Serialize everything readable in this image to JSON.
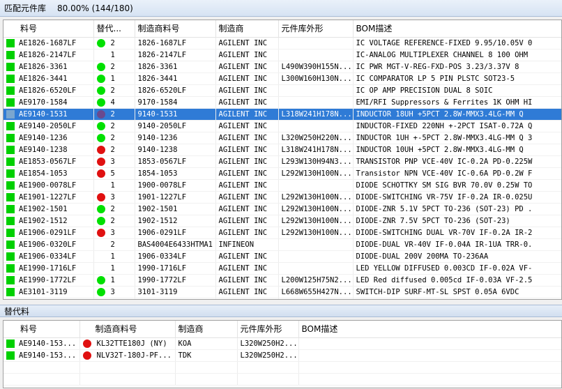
{
  "title": {
    "label": "匹配元件库",
    "progress": "80.00% (144/180)"
  },
  "main_table": {
    "headers": [
      "料号",
      "替代...",
      "制造商料号",
      "制造商",
      "元件库外形",
      "BOM描述"
    ],
    "rows": [
      {
        "part": "AE1826-1687LF",
        "dot": "green",
        "alt": "2",
        "mfr_part": "1826-1687LF",
        "mfr": "AGILENT INC",
        "footprint": "",
        "desc": "IC VOLTAGE REFERENCE-FIXED 9.95/10.05V 0"
      },
      {
        "part": "AE1826-2147LF",
        "dot": "none",
        "alt": "1",
        "mfr_part": "1826-2147LF",
        "mfr": "AGILENT INC",
        "footprint": "",
        "desc": "IC-ANALOG MULTIPLEXER CHANNEL 8 100 OHM"
      },
      {
        "part": "AE1826-3361",
        "dot": "green",
        "alt": "2",
        "mfr_part": "1826-3361",
        "mfr": "AGILENT INC",
        "footprint": "L490W390H155N...",
        "desc": "IC PWR MGT-V-REG-FXD-POS 3.23/3.37V 8"
      },
      {
        "part": "AE1826-3441",
        "dot": "green",
        "alt": "1",
        "mfr_part": "1826-3441",
        "mfr": "AGILENT INC",
        "footprint": "L300W160H130N...",
        "desc": "IC COMPARATOR LP 5 PIN PLSTC SOT23-5"
      },
      {
        "part": "AE1826-6520LF",
        "dot": "green",
        "alt": "2",
        "mfr_part": "1826-6520LF",
        "mfr": "AGILENT INC",
        "footprint": "",
        "desc": "IC OP AMP PRECISION DUAL 8 SOIC"
      },
      {
        "part": "AE9170-1584",
        "dot": "green",
        "alt": "4",
        "mfr_part": "9170-1584",
        "mfr": "AGILENT INC",
        "footprint": "",
        "desc": "EMI/RFI Suppressors & Ferrites 1K OHM HI"
      },
      {
        "part": "AE9140-1531",
        "dot": "purple",
        "alt": "2",
        "mfr_part": "9140-1531",
        "mfr": "AGILENT INC",
        "footprint": "L318W241H178N...",
        "desc": "INDUCTOR 18UH +5PCT 2.8W-MMX3.4LG-MM Q",
        "selected": true
      },
      {
        "part": "AE9140-2050LF",
        "dot": "green",
        "alt": "2",
        "mfr_part": "9140-2050LF",
        "mfr": "AGILENT INC",
        "footprint": "",
        "desc": "INDUCTOR-FIXED 220NH +-2PCT ISAT-0.72A Q"
      },
      {
        "part": "AE9140-1236",
        "dot": "green",
        "alt": "2",
        "mfr_part": "9140-1236",
        "mfr": "AGILENT INC",
        "footprint": "L320W250H220N...",
        "desc": "INDUCTOR 1UH +-5PCT 2.8W-MMX3.4LG-MM Q 3"
      },
      {
        "part": "AE9140-1238",
        "dot": "red",
        "alt": "2",
        "mfr_part": "9140-1238",
        "mfr": "AGILENT INC",
        "footprint": "L318W241H178N...",
        "desc": "INDUCTOR 10UH +5PCT 2.8W-MMX3.4LG-MM Q"
      },
      {
        "part": "AE1853-0567LF",
        "dot": "red",
        "alt": "3",
        "mfr_part": "1853-0567LF",
        "mfr": "AGILENT INC",
        "footprint": "L293W130H94N3...",
        "desc": "TRANSISTOR PNP VCE-40V IC-0.2A PD-0.225W"
      },
      {
        "part": "AE1854-1053",
        "dot": "red",
        "alt": "5",
        "mfr_part": "1854-1053",
        "mfr": "AGILENT INC",
        "footprint": "L292W130H100N...",
        "desc": "Transistor NPN VCE-40V IC-0.6A PD-0.2W F"
      },
      {
        "part": "AE1900-0078LF",
        "dot": "none",
        "alt": "1",
        "mfr_part": "1900-0078LF",
        "mfr": "AGILENT INC",
        "footprint": "",
        "desc": "DIODE SCHOTTKY SM SIG BVR 70.0V 0.25W TO"
      },
      {
        "part": "AE1901-1227LF",
        "dot": "red",
        "alt": "3",
        "mfr_part": "1901-1227LF",
        "mfr": "AGILENT INC",
        "footprint": "L292W130H100N...",
        "desc": "DIODE-SWITCHING VR-75V IF-0.2A IR-0.025U"
      },
      {
        "part": "AE1902-1501",
        "dot": "green",
        "alt": "2",
        "mfr_part": "1902-1501",
        "mfr": "AGILENT INC",
        "footprint": "L292W130H100N...",
        "desc": "DIODE-ZNR 5.1V 5PCT TO-236 (SOT-23) PD ."
      },
      {
        "part": "AE1902-1512",
        "dot": "green",
        "alt": "2",
        "mfr_part": "1902-1512",
        "mfr": "AGILENT INC",
        "footprint": "L292W130H100N...",
        "desc": "DIODE-ZNR 7.5V 5PCT TO-236 (SOT-23)"
      },
      {
        "part": "AE1906-0291LF",
        "dot": "red",
        "alt": "3",
        "mfr_part": "1906-0291LF",
        "mfr": "AGILENT INC",
        "footprint": "L292W130H100N...",
        "desc": "DIODE-SWITCHING DUAL VR-70V IF-0.2A IR-2"
      },
      {
        "part": "AE1906-0320LF",
        "dot": "none",
        "alt": "2",
        "mfr_part": "BAS4004E6433HTMA1",
        "mfr": "INFINEON",
        "footprint": "",
        "desc": "DIODE-DUAL VR-40V IF-0.04A IR-1UA TRR-0."
      },
      {
        "part": "AE1906-0334LF",
        "dot": "none",
        "alt": "1",
        "mfr_part": "1906-0334LF",
        "mfr": "AGILENT INC",
        "footprint": "",
        "desc": "DIODE-DUAL 200V 200MA TO-236AA"
      },
      {
        "part": "AE1990-1716LF",
        "dot": "none",
        "alt": "1",
        "mfr_part": "1990-1716LF",
        "mfr": "AGILENT INC",
        "footprint": "",
        "desc": "LED YELLOW DIFFUSED 0.003CD IF-0.02A VF-"
      },
      {
        "part": "AE1990-1772LF",
        "dot": "green",
        "alt": "1",
        "mfr_part": "1990-1772LF",
        "mfr": "AGILENT INC",
        "footprint": "L200W125H75N2...",
        "desc": "LED Red diffused 0.005cd IF-0.03A VF-2.5"
      },
      {
        "part": "AE3101-3119",
        "dot": "green",
        "alt": "3",
        "mfr_part": "3101-3119",
        "mfr": "AGILENT INC",
        "footprint": "L668W655H427N...",
        "desc": "SWITCH-DIP SURF-MT-SL SPST 0.05A 6VDC"
      }
    ]
  },
  "alt_section": {
    "label": "替代料",
    "headers": [
      "料号",
      "制造商料号",
      "制造商",
      "元件库外形",
      "BOM描述"
    ],
    "rows": [
      {
        "part": "AE9140-153...",
        "dot": "red",
        "mfr_part": "KL32TTE180J (NY)",
        "mfr": "KOA",
        "footprint": "L320W250H2...",
        "desc": ""
      },
      {
        "part": "AE9140-153...",
        "dot": "red",
        "mfr_part": "NLV32T-180J-PF...",
        "mfr": "TDK",
        "footprint": "L320W250H2...",
        "desc": ""
      }
    ]
  },
  "colors": {
    "match_square": "#00d000",
    "status_green": "#00e000",
    "status_red": "#e01010",
    "status_purple": "#6a4a8f",
    "selection": "#2f7bd6"
  }
}
